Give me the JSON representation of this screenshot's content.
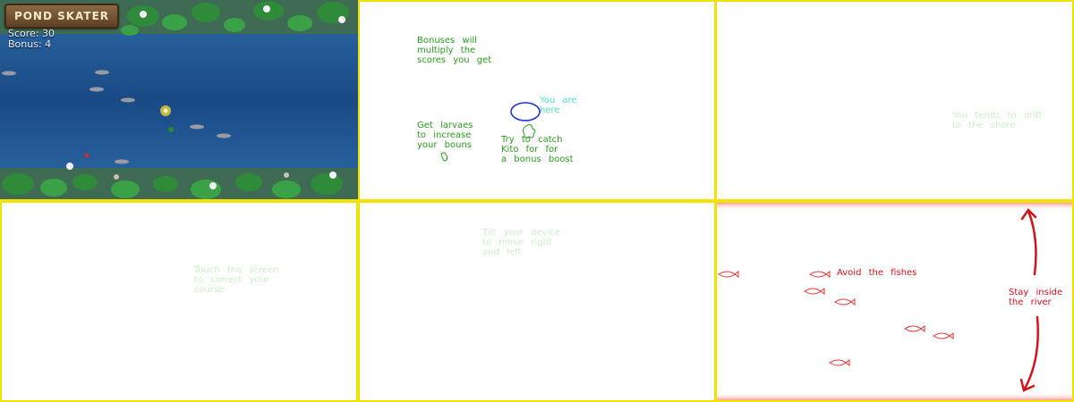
{
  "game": {
    "logo": "POND SKATER",
    "score_label": "Score:",
    "score": "30",
    "bonus_label": "Bonus:",
    "bonus": "4"
  },
  "tutorial": {
    "bonus_multiply": "Bonuses will\nmultiply the\nscores you get",
    "you_are_here": "You are\nhere",
    "larvae": "Get larvaes\nto increase\nyour bouns",
    "kito": "Try to catch\nKito for for\na bonus boost",
    "drift": "You tends to drift\nto the shore",
    "touch": "Touch the screen\nto correct your\ncourse",
    "tilt": "Tilt your device\nto move right\nand left",
    "avoid": "Avoid the fishes",
    "stay": "Stay inside\nthe river"
  },
  "colors": {
    "frame": "#f3e200",
    "water": "#1d4f86",
    "hint_green": "#2a9a1e",
    "hint_cyan": "#55ddc8",
    "hint_pale": "#cdeec8",
    "warning_red": "#d0141c",
    "ellipse_blue": "#1a2fd0"
  }
}
